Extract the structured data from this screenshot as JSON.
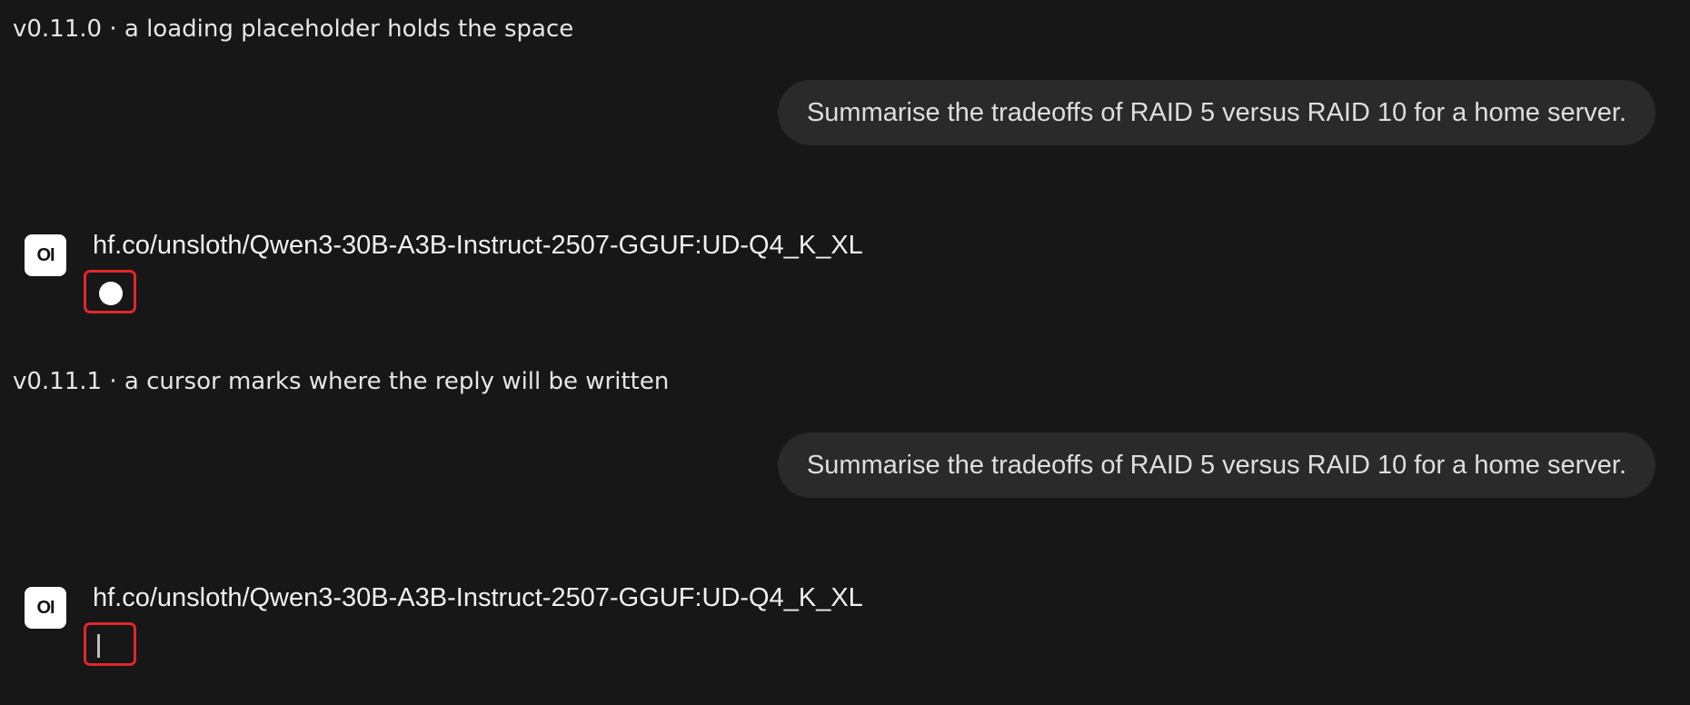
{
  "versions": [
    {
      "caption": "v0.11.0 · a loading placeholder holds the space",
      "user_message": "Summarise the tradeoffs of RAID 5 versus RAID 10 for a home server.",
      "assistant": {
        "avatar_text": "OI",
        "model_name": "hf.co/unsloth/Qwen3-30B-A3B-Instruct-2507-GGUF:UD-Q4_K_XL",
        "indicator": "loading-dot"
      }
    },
    {
      "caption": "v0.11.1 · a cursor marks where the reply will be written",
      "user_message": "Summarise the tradeoffs of RAID 5 versus RAID 10 for a home server.",
      "assistant": {
        "avatar_text": "OI",
        "model_name": "hf.co/unsloth/Qwen3-30B-A3B-Instruct-2507-GGUF:UD-Q4_K_XL",
        "indicator": "text-cursor"
      }
    }
  ],
  "colors": {
    "background": "#171717",
    "bubble": "#2a2a2a",
    "highlight": "#e0282a"
  }
}
